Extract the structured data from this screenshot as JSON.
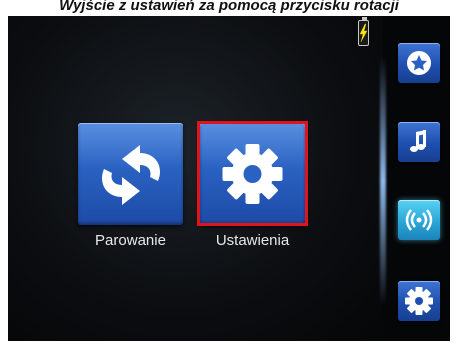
{
  "caption": "Wyjście z ustawień za pomocą przycisku rotacji",
  "status": {
    "battery_icon": "battery-charging-icon"
  },
  "main": {
    "tiles": [
      {
        "label": "Parowanie",
        "icon": "refresh-arrows-icon"
      },
      {
        "label": "Ustawienia",
        "icon": "gear-icon",
        "selected": true
      }
    ]
  },
  "sidebar": {
    "buttons": [
      {
        "name": "favorites",
        "icon": "star-icon"
      },
      {
        "name": "music",
        "icon": "music-note-icon"
      },
      {
        "name": "bluetooth",
        "icon": "signal-waves-icon",
        "active": true
      },
      {
        "name": "settings",
        "icon": "gear-icon"
      }
    ]
  },
  "colors": {
    "selection": "#e3131b",
    "tile_blue": "#2a62c2",
    "active_blue": "#2aa6d8",
    "background": "#050607"
  }
}
